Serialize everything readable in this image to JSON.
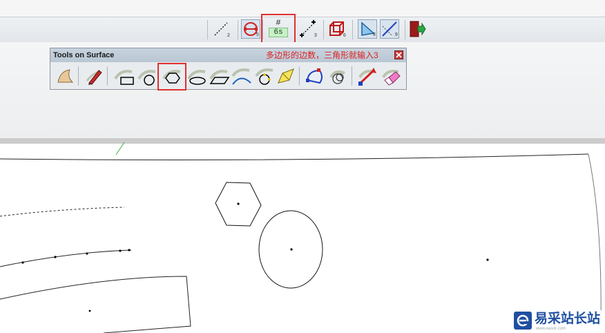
{
  "toolbar": {
    "subscripts": {
      "line": "2",
      "dim": "5",
      "point": "3",
      "cube": "6",
      "tri": "8",
      "slash": "9"
    },
    "count": {
      "hash": "#",
      "value": "6s"
    }
  },
  "panel": {
    "title": "Tools on Surface",
    "note": "多边形的边数，三角形就输入3",
    "tools": [
      "surface-icon",
      "pencil-icon",
      "rectangle-icon",
      "circle-icon",
      "polygon-icon",
      "ellipse-icon",
      "parallelogram-icon",
      "arc-icon",
      "offset-circle-icon",
      "fill-icon",
      "project-icon",
      "loop-icon",
      "reconnect-icon",
      "eraser-icon"
    ],
    "highlighted_tool": "polygon-icon"
  },
  "colors": {
    "highlight": "#e03030",
    "note": "#e02020",
    "canvas": "#ffffff"
  },
  "watermark": {
    "brand": "易采站长站",
    "url": "www.easck.com"
  }
}
